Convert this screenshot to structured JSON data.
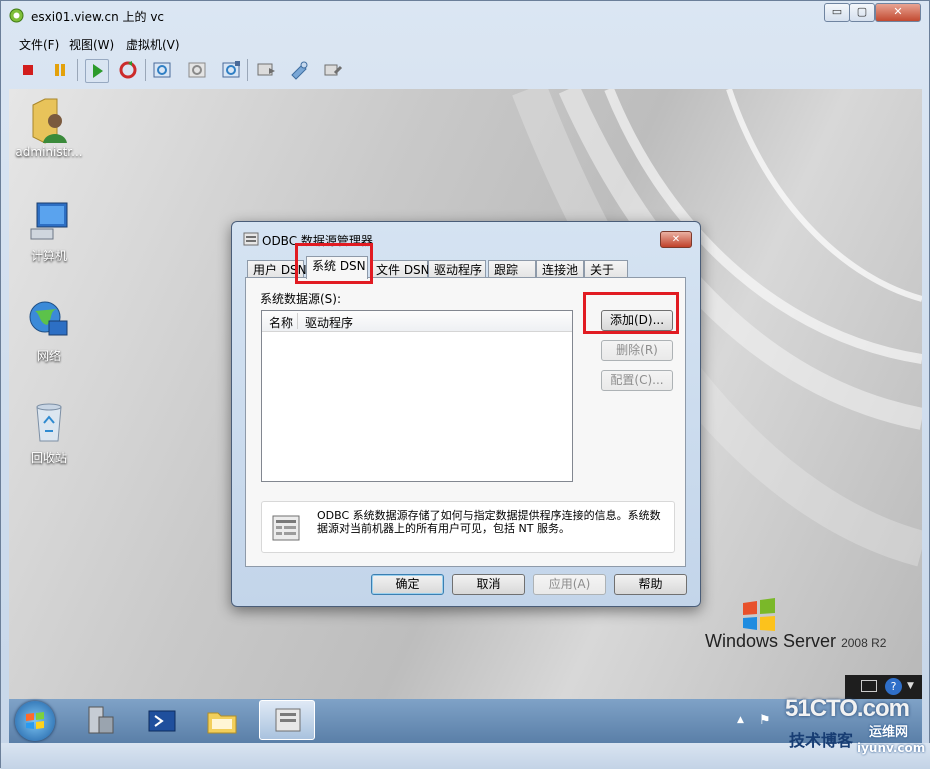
{
  "window": {
    "title": "esxi01.view.cn 上的 vc",
    "controls": {
      "minimize": "▭",
      "maximize": "▢",
      "close": "✕"
    }
  },
  "menu": [
    "文件(F)",
    "视图(W)",
    "虚拟机(V)"
  ],
  "toolbar": {
    "icons": [
      "stop-icon",
      "pause-icon",
      "play-icon",
      "reset-icon",
      "snapshot-icon",
      "revert-snapshot-icon",
      "snapshot-manager-icon",
      "console-icon",
      "settings-icon",
      "devices-icon"
    ]
  },
  "desktop": {
    "icons": [
      {
        "label": "administr...",
        "icon": "user-folder-icon"
      },
      {
        "label": "计算机",
        "icon": "computer-icon"
      },
      {
        "label": "网络",
        "icon": "network-icon"
      },
      {
        "label": "回收站",
        "icon": "recycle-bin-icon"
      }
    ],
    "brand": {
      "windows": "Windows Server",
      "version": "2008 R2"
    }
  },
  "dialog": {
    "title": "ODBC 数据源管理器",
    "tabs": [
      "用户 DSN",
      "系统 DSN",
      "文件 DSN",
      "驱动程序",
      "跟踪",
      "连接池",
      "关于"
    ],
    "active_tab": "系统 DSN",
    "list_label": "系统数据源(S):",
    "columns": [
      "名称",
      "驱动程序"
    ],
    "rows": [],
    "buttons": {
      "add": "添加(D)...",
      "remove": "删除(R)",
      "configure": "配置(C)..."
    },
    "info": "ODBC 系统数据源存储了如何与指定数据提供程序连接的信息。系统数据源对当前机器上的所有用户可见，包括 NT 服务。",
    "footer": {
      "ok": "确定",
      "cancel": "取消",
      "apply": "应用(A)",
      "help": "帮助"
    }
  },
  "watermark": {
    "site": "51CTO.com",
    "sub": "技术博客",
    "net": "运维网",
    "url": "iyunv.com"
  },
  "colors": {
    "highlight": "#e11b22",
    "accent": "#3c7fb1"
  }
}
